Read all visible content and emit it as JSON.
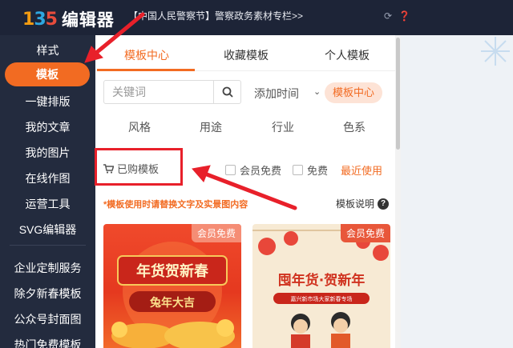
{
  "header": {
    "logo_text": "编辑器",
    "notice": "【中国人民警察节】警察政务素材专栏>>",
    "icons": [
      "refresh-icon",
      "help-icon"
    ]
  },
  "sidebar": {
    "items": [
      {
        "label": "样式"
      },
      {
        "label": "模板",
        "active": true
      },
      {
        "label": "一键排版"
      },
      {
        "label": "我的文章"
      },
      {
        "label": "我的图片"
      },
      {
        "label": "在线作图"
      },
      {
        "label": "运营工具"
      },
      {
        "label": "SVG编辑器"
      },
      {
        "label": "企业定制服务"
      },
      {
        "label": "除夕新春模板"
      },
      {
        "label": "公众号封面图"
      },
      {
        "label": "热门免费模板"
      }
    ]
  },
  "panel": {
    "tabs": [
      {
        "label": "模板中心",
        "active": true
      },
      {
        "label": "收藏模板"
      },
      {
        "label": "个人模板"
      }
    ],
    "search": {
      "placeholder": "关键词"
    },
    "sort": {
      "value": "添加时间"
    },
    "center_pill": "模板中心",
    "filters": [
      "风格",
      "用途",
      "行业",
      "色系"
    ],
    "bought_label": "已购模板",
    "member_free_label": "会员免费",
    "free_label": "免费",
    "recent_label": "最近使用",
    "note": "*模板使用时请替换文字及实景图内容",
    "help_label": "模板说明",
    "cards": [
      {
        "badge": "会员免费",
        "title": "年货贺新春",
        "subtitle": "兔年大吉"
      },
      {
        "badge": "会员免费",
        "title": "囤年货·贺新年",
        "subtitle": "嘉兴新市场大家新春专场"
      }
    ]
  },
  "colors": {
    "accent": "#f26b22",
    "sidebar_bg": "#232b3e",
    "topbar_bg": "#1d2437",
    "annotation_red": "#e8202a"
  }
}
